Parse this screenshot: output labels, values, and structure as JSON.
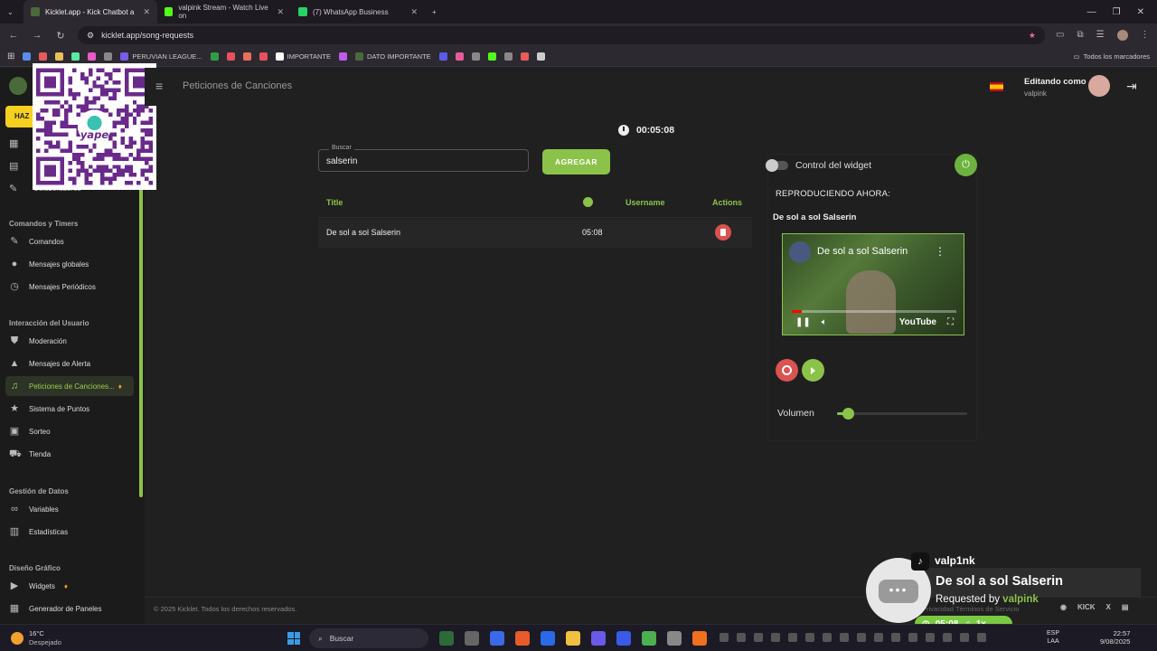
{
  "browser": {
    "tabs": [
      {
        "title": "Kicklet.app - Kick Chatbot a",
        "color": "#4a6a3a",
        "active": true
      },
      {
        "title": "valpink Stream - Watch Live on",
        "color": "#53fc18",
        "active": false
      },
      {
        "title": "(7) WhatsApp Business",
        "color": "#25d366",
        "active": false
      }
    ],
    "url": "kicklet.app/song-requests",
    "bookmarks": [
      {
        "label": "",
        "color": "#5b8de8"
      },
      {
        "label": "",
        "color": "#e85b5b"
      },
      {
        "label": "",
        "color": "#e8c05b"
      },
      {
        "label": "",
        "color": "#5be8a0"
      },
      {
        "label": "",
        "color": "#e85bc8"
      },
      {
        "label": "",
        "color": "#888888"
      },
      {
        "label": "PERUVIAN LEAGUE...",
        "color": "#7a5be8"
      },
      {
        "label": "",
        "color": "#2ea043"
      },
      {
        "label": "",
        "color": "#e8505b"
      },
      {
        "label": "",
        "color": "#e8705b"
      },
      {
        "label": "",
        "color": "#e8505b"
      },
      {
        "label": "IMPORTANTE",
        "color": "#ffffff"
      },
      {
        "label": "",
        "color": "#c05be8"
      },
      {
        "label": "DATO IMPORTANTE",
        "color": "#4a6a3a"
      },
      {
        "label": "",
        "color": "#5b5be8"
      },
      {
        "label": "",
        "color": "#e85b9a"
      },
      {
        "label": "",
        "color": "#888888"
      },
      {
        "label": "",
        "color": "#53fc18"
      },
      {
        "label": "",
        "color": "#888888"
      },
      {
        "label": "",
        "color": "#e85b5b"
      },
      {
        "label": "",
        "color": "#cccccc"
      }
    ],
    "all_bookmarks": "Todos los marcadores"
  },
  "sidebar": {
    "cta_label": "HAZ",
    "partial_item": "Colaboradores",
    "sections": [
      {
        "title": "Comandos y Timers",
        "items": [
          "Comandos",
          "Mensajes globales",
          "Mensajes Periódicos"
        ]
      },
      {
        "title": "Interacción del Usuario",
        "items": [
          "Moderación",
          "Mensajes de Alerta",
          "Peticiones de Canciones...",
          "Sistema de Puntos",
          "Sorteo",
          "Tienda"
        ]
      },
      {
        "title": "Gestión de Datos",
        "items": [
          "Variables",
          "Estadísticas"
        ]
      },
      {
        "title": "Diseño Gráfico",
        "items": [
          "Widgets",
          "Generador de Paneles"
        ]
      }
    ],
    "active_item": "Peticiones de Canciones..."
  },
  "header": {
    "page_title": "Peticiones de Canciones",
    "editing_as": "Editando como",
    "username": "valpink"
  },
  "main": {
    "timer": "00:05:08",
    "search": {
      "label": "Buscar",
      "value": "salserin"
    },
    "add_button": "AGREGAR",
    "table": {
      "headers": {
        "title": "Title",
        "username": "Username",
        "actions": "Actions"
      },
      "rows": [
        {
          "title": "De sol a sol Salserin",
          "duration": "05:08",
          "username": ""
        }
      ]
    }
  },
  "player": {
    "widget_control_label": "Control del widget",
    "now_playing_label": "REPRODUCIENDO AHORA:",
    "now_playing_title": "De sol a sol Salserin",
    "video_title": "De sol a sol Salserin",
    "video_brand": "YouTube",
    "progress": 0.06,
    "volume_label": "Volumen",
    "volume": 0.08
  },
  "footer": {
    "copyright": "© 2025 Kicklet. Todos los derechos reservados.",
    "right_text": "Privacidad    Términos de Servicio"
  },
  "overlay": {
    "user": "valp1nk",
    "song": "De sol a sol Salserin",
    "requested_by_prefix": "Requested by ",
    "requested_by_user": "valpink",
    "icons": [
      "KICK",
      "X"
    ],
    "duration": "05:08",
    "speed": "1x"
  },
  "taskbar": {
    "temperature": "16°C",
    "weather": "Despejado",
    "search_placeholder": "Buscar",
    "lang_line1": "ESP",
    "lang_line2": "LAA",
    "time": "22:57",
    "date": "9/08/2025",
    "apps": [
      "#2d6a3a",
      "#666666",
      "#3a6ae8",
      "#e85b2a",
      "#2a6ae8",
      "#f0c040",
      "#6a5ae8",
      "#3a5ae8",
      "#4caf50",
      "#888888",
      "#f07020"
    ]
  }
}
